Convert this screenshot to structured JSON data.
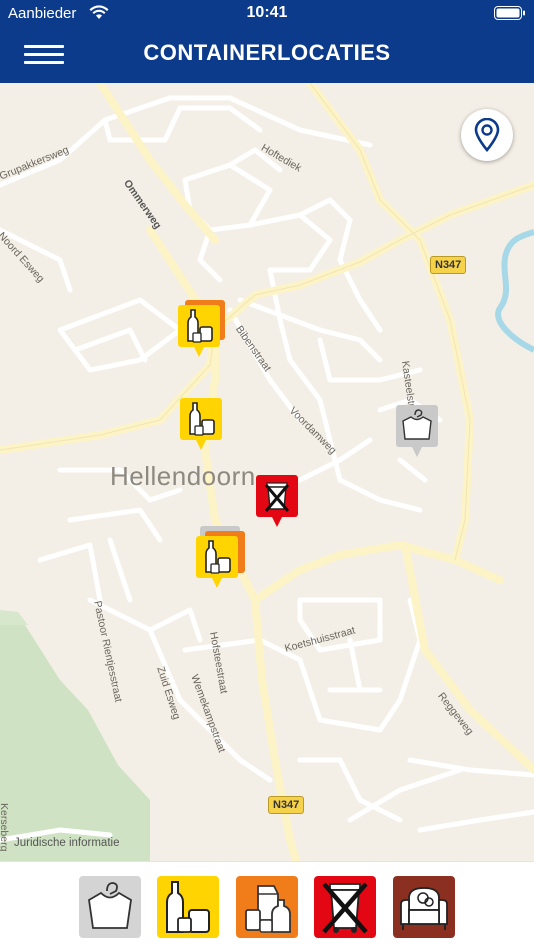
{
  "status_bar": {
    "carrier": "Aanbieder",
    "time": "10:41"
  },
  "header": {
    "title": "CONTAINERLOCATIES",
    "menu_icon": "hamburger-menu-icon"
  },
  "map": {
    "place_name": "Hellendoorn",
    "legal_link": "Juridische informatie",
    "road_shields": [
      "N347",
      "N347"
    ],
    "streets": [
      "Ommerweg",
      "Hoftediek",
      "Grupakkersweg",
      "Noord Esweg",
      "Bibenstraat",
      "Voordamweg",
      "Kasteelstr.",
      "Pastoor Rientjesstraat",
      "Zuid Esweg",
      "Hofsteestraat",
      "Wemekampstraat",
      "Koetshuisstraat",
      "Reggeweg",
      "Kerseberg"
    ],
    "locate_button_icon": "map-pin-icon",
    "markers": [
      {
        "type": "glass",
        "color": "#ffd400"
      },
      {
        "type": "glass",
        "color": "#ffd400"
      },
      {
        "type": "glass",
        "color": "#ffd400"
      },
      {
        "type": "textile",
        "color": "#c9c9c9"
      },
      {
        "type": "residual-waste",
        "color": "#e30613"
      },
      {
        "type": "packaging",
        "color": "#f07d1a"
      }
    ]
  },
  "categories": [
    {
      "id": "textile",
      "icon": "clothing-icon",
      "color": "#d4d4d4"
    },
    {
      "id": "glass",
      "icon": "glass-bottles-icon",
      "color": "#ffd400"
    },
    {
      "id": "packaging",
      "icon": "packaging-icon",
      "color": "#f07d1a"
    },
    {
      "id": "residual-waste",
      "icon": "crossed-bin-icon",
      "color": "#e30613"
    },
    {
      "id": "bulky-waste",
      "icon": "armchair-icon",
      "color": "#8b2f20"
    }
  ]
}
